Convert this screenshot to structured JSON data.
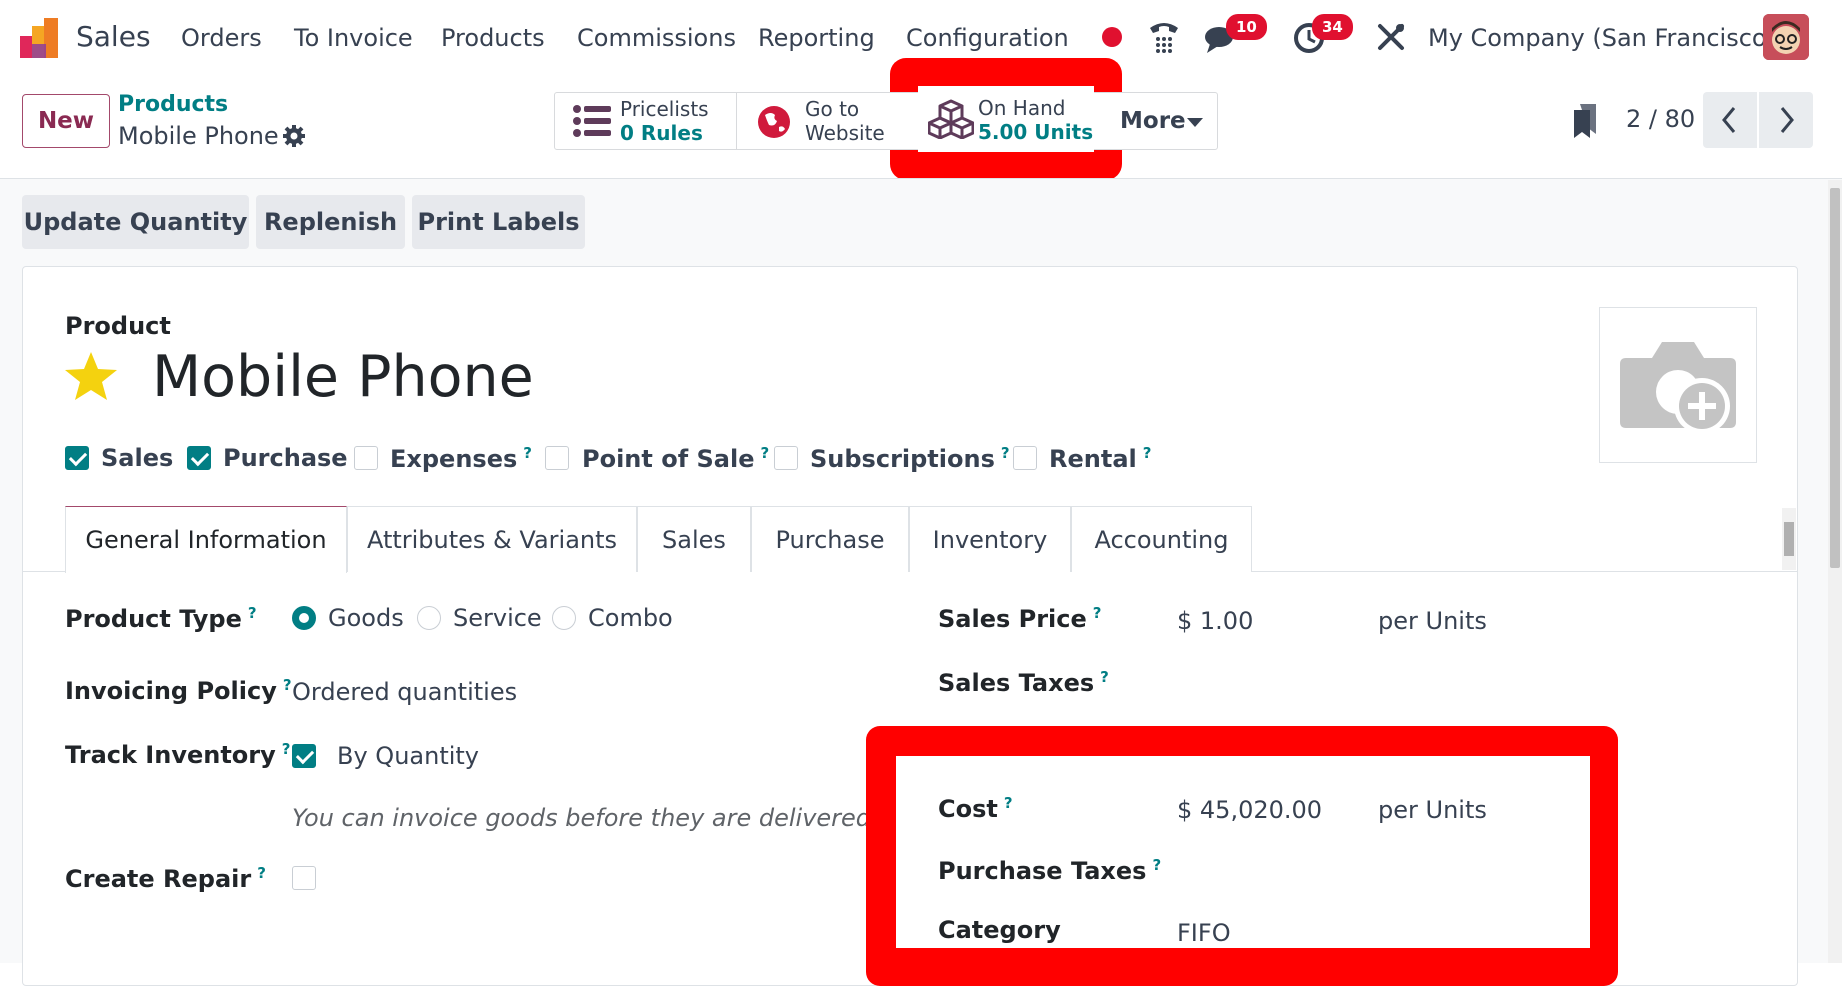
{
  "navbar": {
    "app_name": "Sales",
    "menu": [
      "Orders",
      "To Invoice",
      "Products",
      "Commissions",
      "Reporting",
      "Configuration"
    ],
    "messages_badge": "10",
    "activities_badge": "34",
    "company": "My Company (San Francisco)"
  },
  "control_panel": {
    "new_label": "New",
    "breadcrumb_parent": "Products",
    "breadcrumb_current": "Mobile Phone",
    "smart_buttons": {
      "pricelists_label": "Pricelists",
      "pricelists_value": "0 Rules",
      "website_line1": "Go to",
      "website_line2": "Website",
      "onhand_label": "On Hand",
      "onhand_value": "5.00 Units",
      "more_label": "More"
    },
    "pager": "2 / 80"
  },
  "actions": {
    "update_quantity": "Update Quantity",
    "replenish": "Replenish",
    "print_labels": "Print Labels"
  },
  "form": {
    "product_label": "Product",
    "product_name": "Mobile Phone",
    "flags": [
      {
        "label": "Sales",
        "checked": true
      },
      {
        "label": "Purchase",
        "checked": true
      },
      {
        "label": "Expenses",
        "checked": false
      },
      {
        "label": "Point of Sale",
        "checked": false
      },
      {
        "label": "Subscriptions",
        "checked": false
      },
      {
        "label": "Rental",
        "checked": false
      }
    ],
    "tabs": [
      "General Information",
      "Attributes & Variants",
      "Sales",
      "Purchase",
      "Inventory",
      "Accounting"
    ],
    "product_type_label": "Product Type",
    "product_type_options": [
      "Goods",
      "Service",
      "Combo"
    ],
    "invoicing_policy_label": "Invoicing Policy",
    "invoicing_policy_value": "Ordered quantities",
    "track_inventory_label": "Track Inventory",
    "track_inventory_value": "By Quantity",
    "hint": "You can invoice goods before they are delivered.",
    "create_repair_label": "Create Repair",
    "sales_price_label": "Sales Price",
    "sales_price_value": "$ 1.00",
    "per_units": "per Units",
    "sales_taxes_label": "Sales Taxes",
    "cost_label": "Cost",
    "cost_value": "$ 45,020.00",
    "purchase_taxes_label": "Purchase Taxes",
    "category_label": "Category",
    "category_value": "FIFO"
  },
  "colors": {
    "accent": "#017e84",
    "brand": "#a3496b",
    "highlight": "#ff0000",
    "badge": "#e0102f"
  }
}
